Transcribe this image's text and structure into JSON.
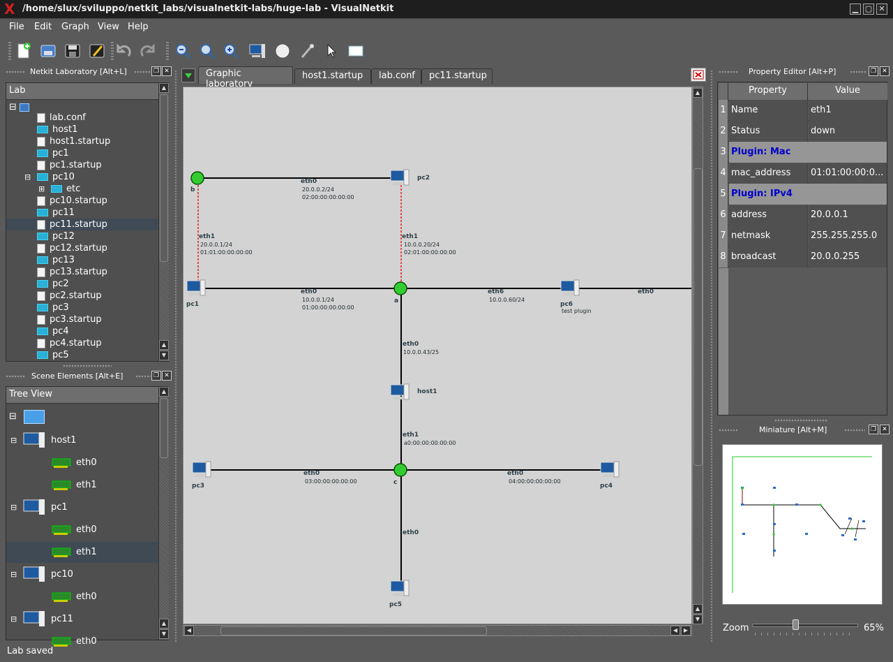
{
  "window": {
    "title": "/home/slux/sviluppo/netkit_labs/visualnetkit-labs/huge-lab - VisualNetkit"
  },
  "menu": [
    "File",
    "Edit",
    "Graph",
    "View",
    "Help"
  ],
  "lab_dock": {
    "title": "Netkit Laboratory [Alt+L]",
    "header": "Lab",
    "items": [
      "lab.conf",
      "host1",
      "host1.startup",
      "pc1",
      "pc1.startup",
      "pc10",
      "etc",
      "pc10.startup",
      "pc11",
      "pc11.startup",
      "pc12",
      "pc12.startup",
      "pc13",
      "pc13.startup",
      "pc2",
      "pc2.startup",
      "pc3",
      "pc3.startup",
      "pc4",
      "pc4.startup",
      "pc5"
    ],
    "selected": "pc11.startup"
  },
  "scene_dock": {
    "title": "Scene Elements [Alt+E]",
    "header": "Tree View",
    "items": [
      "host1",
      "eth0",
      "eth1",
      "pc1",
      "eth0",
      "eth1",
      "pc10",
      "eth0",
      "pc11",
      "eth0"
    ],
    "selected": "eth1"
  },
  "tabs": [
    "Graphic laboratory",
    "host1.startup",
    "lab.conf",
    "pc11.startup"
  ],
  "graph": {
    "nodes": {
      "b": "b",
      "pc2": "pc2",
      "pc1": "pc1",
      "a": "a",
      "pc6": "pc6",
      "pc6_note": "test plugin",
      "host1": "host1",
      "pc3": "pc3",
      "c": "c",
      "pc4": "pc4",
      "pc5": "pc5"
    },
    "labels": {
      "l1_name": "eth0",
      "l1_ip": "20.0.0.2/24",
      "l1_mac": "02:00:00:00:00:00",
      "l2_name": "eth1",
      "l2_ip": "20.0.0.1/24",
      "l2_mac": "01:01:00:00:00:00",
      "l3_name": "eth1",
      "l3_ip": "10.0.0.20/24",
      "l3_mac": "02:01:00:00:00:00",
      "l4_name": "eth0",
      "l4_ip": "10.0.0.1/24",
      "l4_mac": "01:00:00:00:00:00",
      "l5_name": "eth6",
      "l5_ip": "10.0.0.60/24",
      "l6_name": "eth0",
      "l7_name": "eth0",
      "l7_ip": "10.0.0.43/25",
      "l8_name": "eth1",
      "l8_mac": "a0:00:00:00:00:00",
      "l9_name": "eth0",
      "l9_mac": "03:00:00:00:00:00",
      "l10_name": "eth0",
      "l10_mac": "04:00:00:00:00:00",
      "l11_name": "eth0"
    }
  },
  "property_dock": {
    "title": "Property Editor [Alt+P]",
    "col_property": "Property",
    "col_value": "Value",
    "rows": [
      {
        "n": "1",
        "k": "Name",
        "v": "eth1"
      },
      {
        "n": "2",
        "k": "Status",
        "v": "down"
      },
      {
        "n": "3",
        "plugin": "Plugin: Mac"
      },
      {
        "n": "4",
        "k": "mac_address",
        "v": "01:01:00:00:0..."
      },
      {
        "n": "5",
        "plugin": "Plugin: IPv4"
      },
      {
        "n": "6",
        "k": "address",
        "v": "20.0.0.1"
      },
      {
        "n": "7",
        "k": "netmask",
        "v": "255.255.255.0"
      },
      {
        "n": "8",
        "k": "broadcast",
        "v": "20.0.0.255"
      }
    ]
  },
  "miniature_dock": {
    "title": "Miniature [Alt+M]",
    "zoom_label": "Zoom",
    "zoom_value": "65%",
    "zoom_level": 0.4
  },
  "status": "Lab saved"
}
